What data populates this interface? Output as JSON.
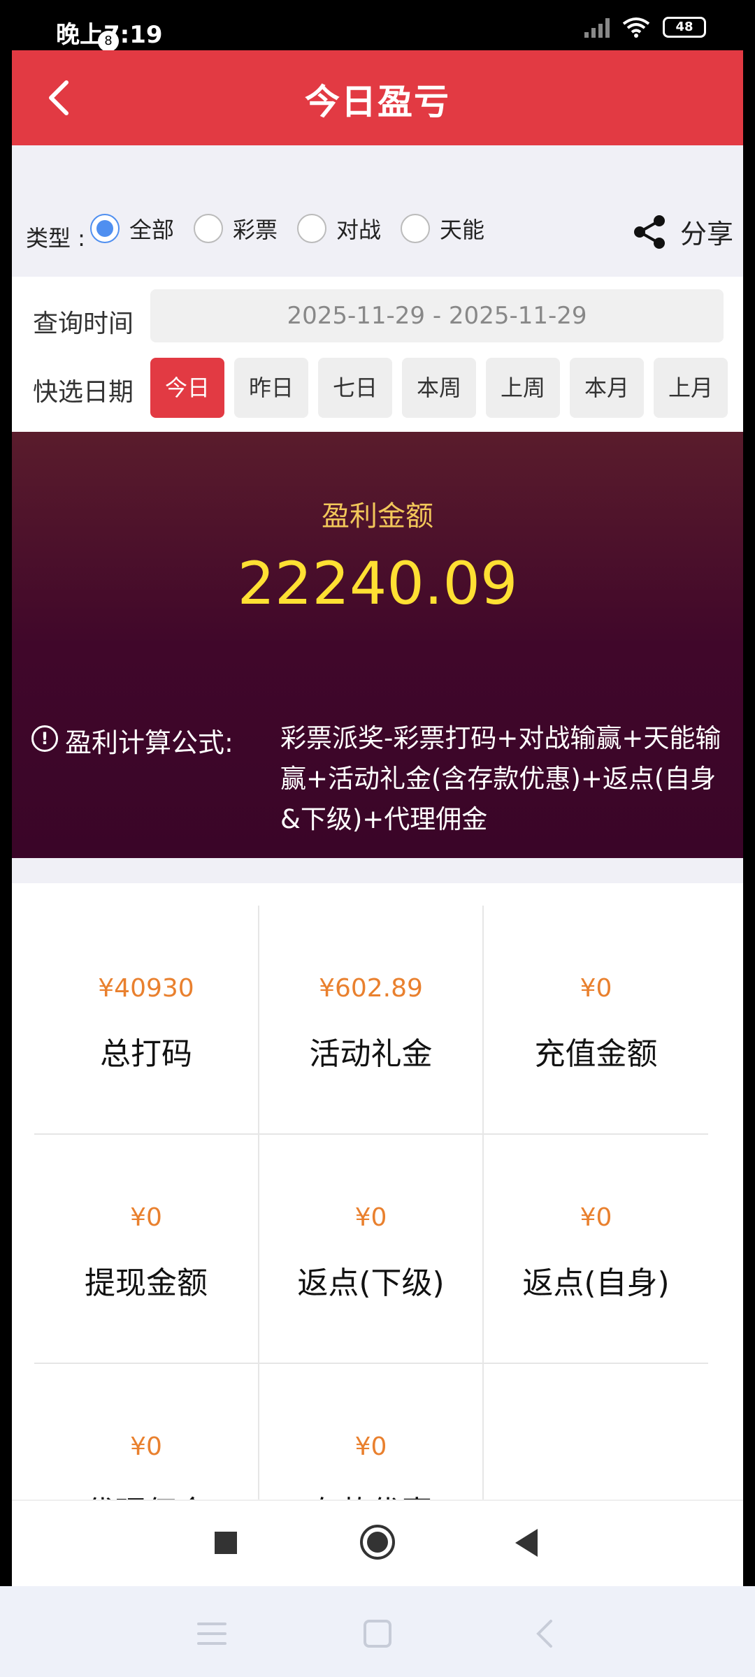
{
  "status_bar": {
    "time": "晚上7:19",
    "notification_badge": "8",
    "battery": "48"
  },
  "header": {
    "title": "今日盈亏"
  },
  "type_filter": {
    "label": "类型 :",
    "options": [
      {
        "label": "全部",
        "checked": true
      },
      {
        "label": "彩票",
        "checked": false
      },
      {
        "label": "对战",
        "checked": false
      },
      {
        "label": "天能",
        "checked": false
      }
    ],
    "share_label": "分享"
  },
  "date_filter": {
    "query_label": "查询时间",
    "date_range": "2025-11-29 - 2025-11-29",
    "quick_label": "快选日期",
    "quick_options": [
      {
        "label": "今日",
        "active": true
      },
      {
        "label": "昨日",
        "active": false
      },
      {
        "label": "七日",
        "active": false
      },
      {
        "label": "本周",
        "active": false
      },
      {
        "label": "上周",
        "active": false
      },
      {
        "label": "本月",
        "active": false
      },
      {
        "label": "上月",
        "active": false
      }
    ]
  },
  "profit": {
    "label": "盈利金额",
    "amount": "22240.09",
    "formula_label": "盈利计算公式:",
    "formula_text": "彩票派奖-彩票打码+对战输赢+天能输赢+活动礼金(含存款优惠)+返点(自身&下级)+代理佣金"
  },
  "stats": [
    {
      "value": "¥40930",
      "label": "总打码"
    },
    {
      "value": "¥602.89",
      "label": "活动礼金"
    },
    {
      "value": "¥0",
      "label": "充值金额"
    },
    {
      "value": "¥0",
      "label": "提现金额"
    },
    {
      "value": "¥0",
      "label": "返点(下级)"
    },
    {
      "value": "¥0",
      "label": "返点(自身)"
    },
    {
      "value": "¥0",
      "label": "代理佣金"
    },
    {
      "value": "¥0",
      "label": "存款优惠"
    },
    {
      "value": "",
      "label": ""
    }
  ],
  "colors": {
    "accent": "#e23a43",
    "radio": "#4f8ff0",
    "profit_text": "#ffe033",
    "stat_value": "#e9802e",
    "banner_dark": "#3a0528"
  }
}
